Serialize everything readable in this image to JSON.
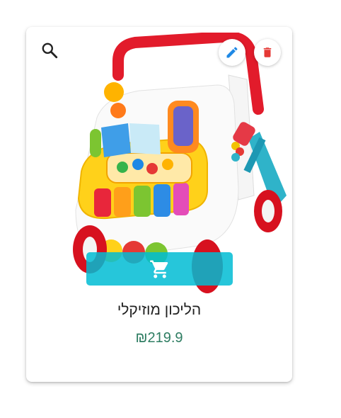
{
  "product": {
    "title": "הליכון מוזיקלי",
    "price": "₪219.9"
  },
  "icons": {
    "search": "search-icon",
    "edit": "pencil-icon",
    "delete": "trash-icon",
    "cart": "shopping-cart-icon"
  },
  "colors": {
    "edit_icon": "#1e88e5",
    "delete_icon": "#e53935",
    "cart_button": "#00bcd4",
    "price": "#2e7d62"
  }
}
